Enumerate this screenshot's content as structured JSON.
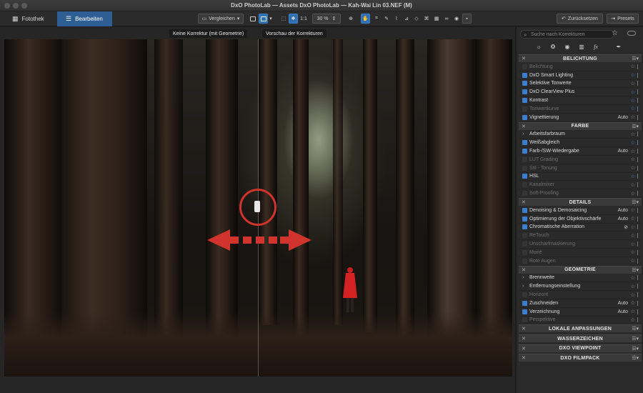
{
  "window": {
    "title": "DxO PhotoLab — Assets DxO PhotoLab — Kah-Wai Lin 03.NEF (M)"
  },
  "toolbar": {
    "tab_library": "Fotothek",
    "tab_edit": "Bearbeiten",
    "compare_label": "Vergleichen",
    "ratio_label": "1:1",
    "zoom_value": "30 %",
    "reset_label": "Zurücksetzen",
    "presets_label": "Presets"
  },
  "viewer": {
    "left_label": "Keine Korrektur (mit Geometrie)",
    "right_label": "Vorschau der Korrekturen",
    "split_position_fraction": 0.5
  },
  "annotation": {
    "arrow_color": "#d0342c"
  },
  "panel": {
    "search_placeholder": "Suche nach Korrekturen",
    "sections": [
      {
        "title": "BELICHTUNG",
        "rows": [
          {
            "label": "Belichtung",
            "enabled": false,
            "value": ""
          },
          {
            "label": "DxO Smart Lighting",
            "enabled": true,
            "value": "",
            "fav": true
          },
          {
            "label": "Selektive Tonwerte",
            "enabled": true,
            "value": ""
          },
          {
            "label": "DxO ClearView Plus",
            "enabled": true,
            "value": "",
            "fav": true
          },
          {
            "label": "Kontrast",
            "enabled": true,
            "value": "",
            "fav": true
          },
          {
            "label": "Tonwertkurve",
            "enabled": false,
            "value": "",
            "fav": true
          },
          {
            "label": "Vignettierung",
            "enabled": true,
            "value": "Auto"
          }
        ]
      },
      {
        "title": "FARBE",
        "rows": [
          {
            "label": "Arbeitsfarbraum",
            "enabled": true,
            "value": "",
            "arrow": true
          },
          {
            "label": "Weißabgleich",
            "enabled": true,
            "value": "",
            "fav": true
          },
          {
            "label": "Farb-/SW-Wiedergabe",
            "enabled": true,
            "value": "Auto"
          },
          {
            "label": "LUT Grading",
            "enabled": false,
            "value": ""
          },
          {
            "label": "Stil - Tonung",
            "enabled": false,
            "value": ""
          },
          {
            "label": "HSL",
            "enabled": true,
            "value": "",
            "fav": true
          },
          {
            "label": "Kanalmixer",
            "enabled": false,
            "value": ""
          },
          {
            "label": "Soft-Proofing",
            "enabled": false,
            "value": ""
          }
        ]
      },
      {
        "title": "DETAILS",
        "rows": [
          {
            "label": "Denoising & Demosaicing",
            "enabled": true,
            "value": "Auto"
          },
          {
            "label": "Optimierung der Objektivschärfe",
            "enabled": true,
            "value": "Auto"
          },
          {
            "label": "Chromatische Aberration",
            "enabled": true,
            "value": "",
            "eye": true
          },
          {
            "label": "ReTouch",
            "enabled": false,
            "value": ""
          },
          {
            "label": "Unscharfmaskierung",
            "enabled": false,
            "value": ""
          },
          {
            "label": "Moiré",
            "enabled": false,
            "value": ""
          },
          {
            "label": "Rote Augen",
            "enabled": false,
            "value": ""
          }
        ]
      },
      {
        "title": "GEOMETRIE",
        "rows": [
          {
            "label": "Brennweite",
            "enabled": true,
            "value": "",
            "arrow": true
          },
          {
            "label": "Entfernungseinstellung",
            "enabled": true,
            "value": "",
            "arrow": true
          },
          {
            "label": "Horizont",
            "enabled": false,
            "value": ""
          },
          {
            "label": "Zuschneiden",
            "enabled": true,
            "value": "Auto"
          },
          {
            "label": "Verzeichnung",
            "enabled": true,
            "value": "Auto"
          },
          {
            "label": "Perspektive",
            "enabled": false,
            "value": ""
          }
        ]
      }
    ],
    "collapsed_sections": [
      "LOKALE ANPASSUNGEN",
      "WASSERZEICHEN",
      "DXO VIEWPOINT",
      "DXO FILMPACK"
    ]
  }
}
